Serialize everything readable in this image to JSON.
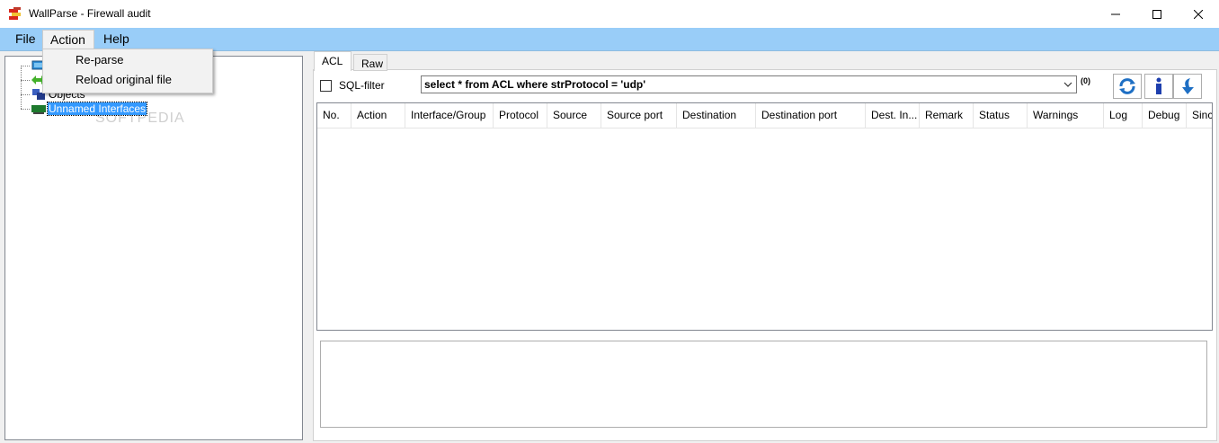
{
  "window": {
    "title": "WallParse - Firewall audit"
  },
  "menu": {
    "file": "File",
    "action": "Action",
    "help": "Help"
  },
  "action_menu": {
    "items": [
      "Re-parse",
      "Reload original file"
    ]
  },
  "tree": {
    "items": [
      {
        "label": "",
        "icon": "interfaces-icon"
      },
      {
        "label": "",
        "icon": "arrows-icon"
      },
      {
        "label": "Objects",
        "icon": "objects-icon"
      },
      {
        "label": "Unnamed Interfaces",
        "icon": "network-card-icon",
        "selected": true
      }
    ]
  },
  "tabs": [
    "ACL",
    "Raw"
  ],
  "filter": {
    "checkbox_label": "SQL-filter",
    "query": "select * from ACL where strProtocol = 'udp'",
    "count": "(0)"
  },
  "grid": {
    "columns": [
      "No.",
      "Action",
      "Interface/Group",
      "Protocol",
      "Source",
      "Source port",
      "Destination",
      "Destination port",
      "Dest. In...",
      "Remark",
      "Status",
      "Warnings",
      "Log",
      "Debug",
      "Sinc"
    ],
    "rows": []
  },
  "watermark": "SOFTPEDIA",
  "colors": {
    "menubar": "#99cdf8",
    "selection": "#3399ff",
    "button_blue": "#1e6fc4"
  }
}
